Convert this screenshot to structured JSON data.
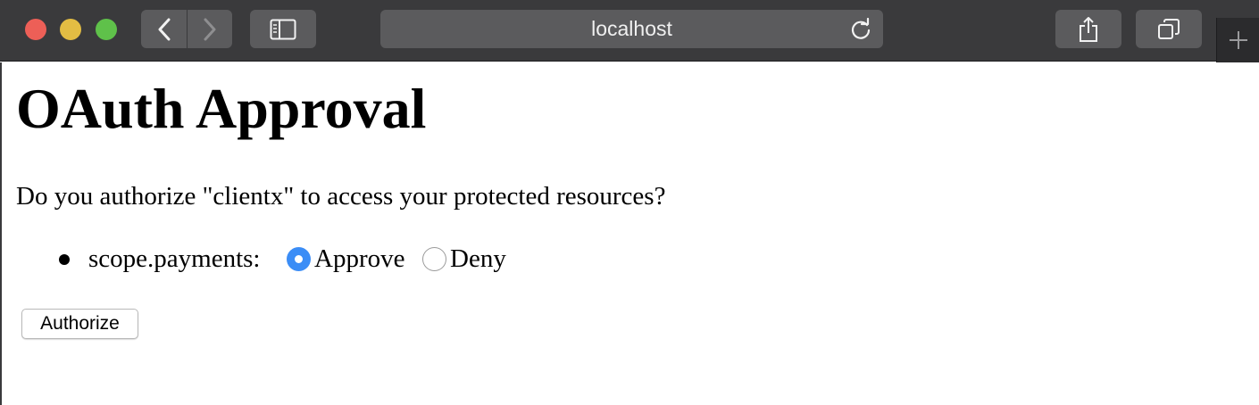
{
  "browser": {
    "address_bar": {
      "url": "localhost"
    },
    "icons": {
      "back": "chevron-left-icon",
      "forward": "chevron-right-icon",
      "sidebar": "sidebar-icon",
      "reload": "reload-icon",
      "share": "share-icon",
      "tabs": "tabs-overview-icon",
      "new_tab": "plus-icon"
    },
    "colors": {
      "toolbar": "#3a3a3c",
      "button": "#5b5b5d",
      "close": "#ed5f57",
      "minimize": "#e3bd43",
      "zoom": "#5fc14a"
    }
  },
  "page": {
    "title": "OAuth Approval",
    "question": "Do you authorize \"clientx\" to access your protected resources?",
    "scopes": [
      {
        "name": "scope.payments:",
        "approve_label": "Approve",
        "deny_label": "Deny",
        "selected": "approve"
      }
    ],
    "submit_label": "Authorize",
    "colors": {
      "radio_selected": "#3b8df6"
    }
  }
}
